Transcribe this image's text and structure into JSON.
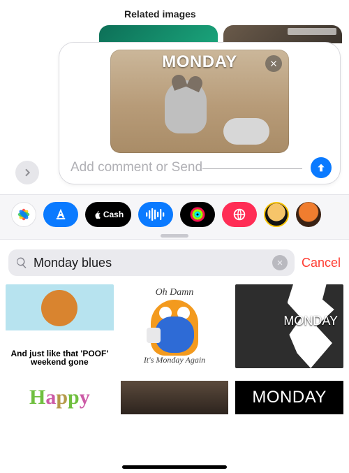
{
  "header": {
    "related_heading": "Related images"
  },
  "compose": {
    "preview_caption": "MONDAY",
    "close_icon": "close-icon",
    "placeholder": "Add comment or Send",
    "value": "",
    "send_icon": "arrow-up-icon",
    "expand_icon": "chevron-right-icon"
  },
  "drawer": {
    "items": [
      {
        "id": "photos",
        "name": "photos-app-icon"
      },
      {
        "id": "appstore",
        "name": "app-store-icon"
      },
      {
        "id": "cash",
        "name": "apple-cash-icon",
        "label": "Cash"
      },
      {
        "id": "audio",
        "name": "audio-wave-icon"
      },
      {
        "id": "fitness",
        "name": "fitness-rings-icon"
      },
      {
        "id": "browse",
        "name": "web-search-icon"
      },
      {
        "id": "memoji1",
        "name": "memoji-icon"
      },
      {
        "id": "memoji2",
        "name": "memoji-icon"
      }
    ]
  },
  "search": {
    "icon": "magnifying-glass-icon",
    "query": "Monday blues",
    "clear_icon": "clear-icon",
    "cancel_label": "Cancel"
  },
  "results": {
    "row1": [
      {
        "caption_bottom": "And just like that\n'POOF' weekend gone"
      },
      {
        "caption_top": "Oh Damn",
        "caption_bottom": "It's Monday Again"
      },
      {
        "label": "MONDAY"
      }
    ],
    "row2": [
      {
        "text": "Happy"
      },
      {
        "text": ""
      },
      {
        "text": "MONDAY"
      }
    ]
  }
}
